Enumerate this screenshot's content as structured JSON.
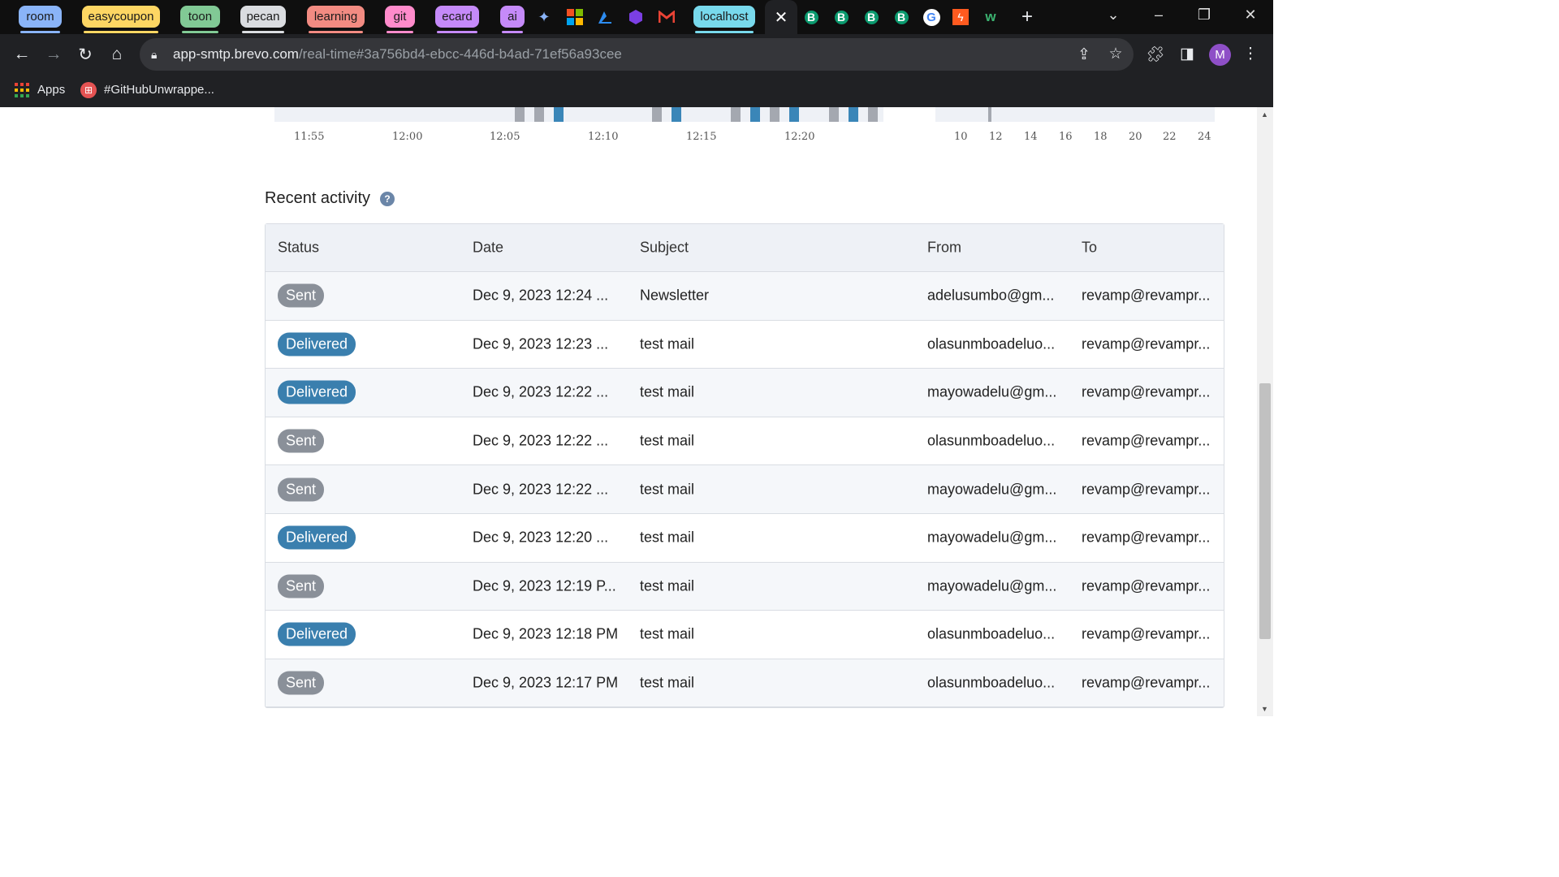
{
  "browser": {
    "tab_groups": [
      {
        "label": "room",
        "color": "#8ab4f8"
      },
      {
        "label": "easycoupon",
        "color": "#fdd663"
      },
      {
        "label": "toon",
        "color": "#81c995"
      },
      {
        "label": "pecan",
        "color": "#dadce0"
      },
      {
        "label": "learning",
        "color": "#f28b82"
      },
      {
        "label": "git",
        "color": "#ff8bcb"
      },
      {
        "label": "ecard",
        "color": "#c58af9"
      },
      {
        "label": "ai",
        "color": "#c58af9"
      },
      {
        "label": "localhost",
        "color": "#78d9ec"
      }
    ],
    "active_tab_close": "✕",
    "new_tab": "+",
    "b_icon": "B",
    "address": {
      "host": "app-smtp.brevo.com",
      "path": "/real-time#3a756bd4-ebcc-446d-b4ad-71ef56a93cee"
    },
    "profile_initial": "M",
    "bookmarks": [
      {
        "label": "Apps"
      },
      {
        "label": "#GitHubUnwrappe..."
      }
    ]
  },
  "chart": {
    "left_ticks": [
      "11:55",
      "12:00",
      "12:05",
      "12:10",
      "12:15",
      "12:20"
    ],
    "right_ticks": [
      "10",
      "12",
      "14",
      "16",
      "18",
      "20",
      "22",
      "24"
    ]
  },
  "recent_activity": {
    "title": "Recent activity",
    "help": "?",
    "columns": [
      "Status",
      "Date",
      "Subject",
      "From",
      "To"
    ],
    "rows": [
      {
        "status": "Sent",
        "date": "Dec 9, 2023 12:24 ...",
        "subject": "Newsletter",
        "from": "adelusumbo@gm...",
        "to": "revamp@revampr..."
      },
      {
        "status": "Delivered",
        "date": "Dec 9, 2023 12:23 ...",
        "subject": "test mail",
        "from": "olasunmboadeluo...",
        "to": "revamp@revampr..."
      },
      {
        "status": "Delivered",
        "date": "Dec 9, 2023 12:22 ...",
        "subject": "test mail",
        "from": "mayowadelu@gm...",
        "to": "revamp@revampr..."
      },
      {
        "status": "Sent",
        "date": "Dec 9, 2023 12:22 ...",
        "subject": "test mail",
        "from": "olasunmboadeluo...",
        "to": "revamp@revampr..."
      },
      {
        "status": "Sent",
        "date": "Dec 9, 2023 12:22 ...",
        "subject": "test mail",
        "from": "mayowadelu@gm...",
        "to": "revamp@revampr..."
      },
      {
        "status": "Delivered",
        "date": "Dec 9, 2023 12:20 ...",
        "subject": "test mail",
        "from": "mayowadelu@gm...",
        "to": "revamp@revampr..."
      },
      {
        "status": "Sent",
        "date": "Dec 9, 2023 12:19 P...",
        "subject": "test mail",
        "from": "mayowadelu@gm...",
        "to": "revamp@revampr..."
      },
      {
        "status": "Delivered",
        "date": "Dec 9, 2023 12:18 PM",
        "subject": "test mail",
        "from": "olasunmboadeluo...",
        "to": "revamp@revampr..."
      },
      {
        "status": "Sent",
        "date": "Dec 9, 2023 12:17 PM",
        "subject": "test mail",
        "from": "olasunmboadeluo...",
        "to": "revamp@revampr..."
      }
    ]
  },
  "colors": {
    "sent": "#8a9099",
    "delivered": "#3a7fae",
    "bar_gray": "#a4a8b0",
    "bar_blue": "#3a86b8"
  }
}
